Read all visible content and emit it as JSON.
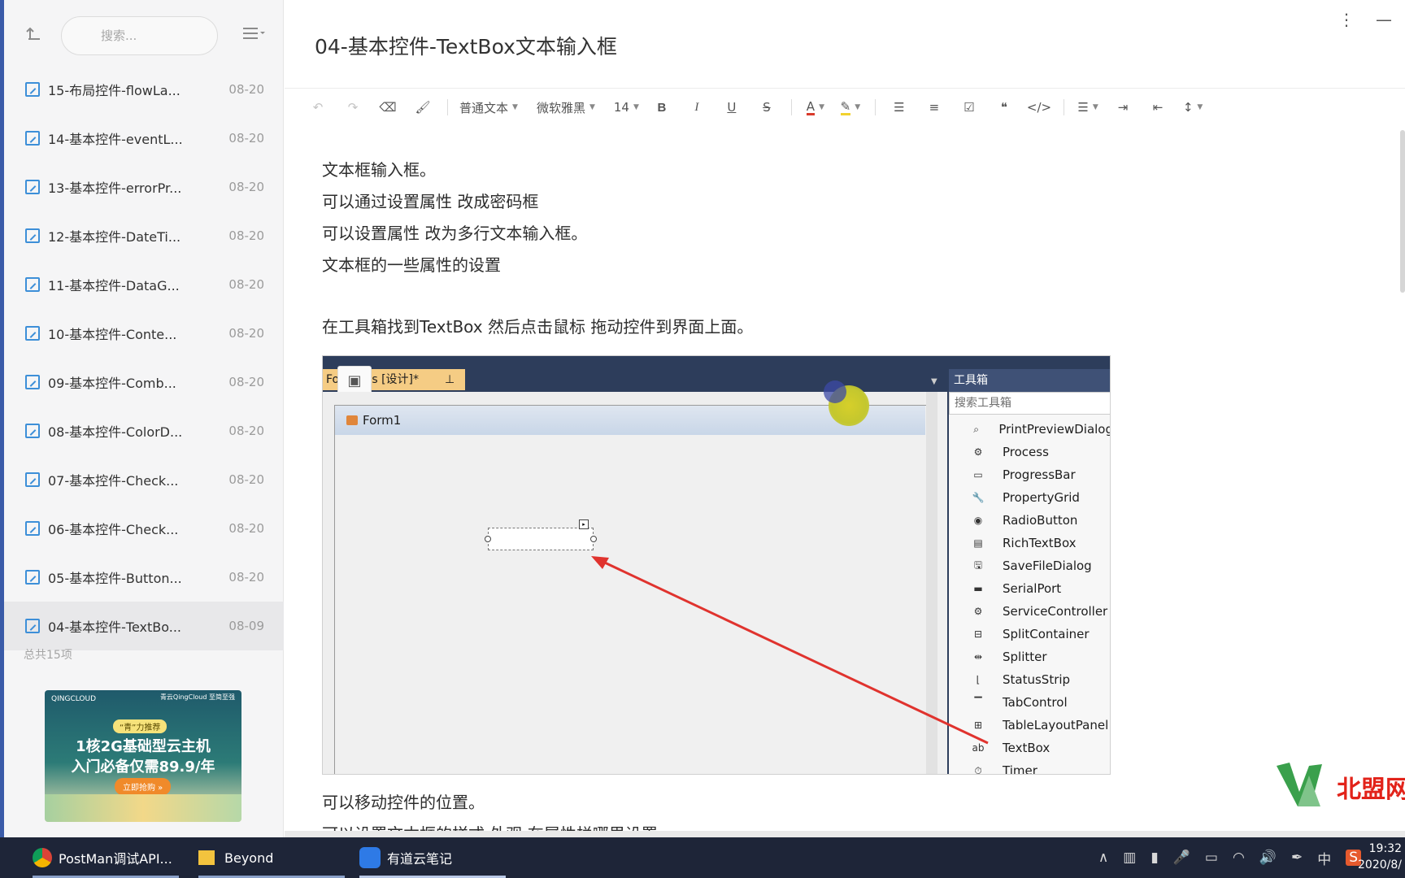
{
  "sidebar": {
    "search_placeholder": "搜索...",
    "items": [
      {
        "title": "15-布局控件-flowLa...",
        "date": "08-20"
      },
      {
        "title": "14-基本控件-eventL...",
        "date": "08-20"
      },
      {
        "title": "13-基本控件-errorPr...",
        "date": "08-20"
      },
      {
        "title": "12-基本控件-DateTi...",
        "date": "08-20"
      },
      {
        "title": "11-基本控件-DataG...",
        "date": "08-20"
      },
      {
        "title": "10-基本控件-Conte...",
        "date": "08-20"
      },
      {
        "title": "09-基本控件-Comb...",
        "date": "08-20"
      },
      {
        "title": "08-基本控件-ColorD...",
        "date": "08-20"
      },
      {
        "title": "07-基本控件-Check...",
        "date": "08-20"
      },
      {
        "title": "06-基本控件-Check...",
        "date": "08-20"
      },
      {
        "title": "05-基本控件-Button...",
        "date": "08-20"
      },
      {
        "title": "04-基本控件-TextBo...",
        "date": "08-09"
      }
    ],
    "count": "总共15项",
    "ad": {
      "brand": "QINGCLOUD",
      "top_right": "青云QingCloud 至简至强",
      "pill": "“青”力推荐",
      "line1": "1核2G基础型云主机",
      "line2": "入门必备仅需89.9/年",
      "button": "立即抢购 »"
    }
  },
  "doc": {
    "title": "04-基本控件-TextBox文本输入框",
    "toolbar": {
      "paragraph": "普通文本",
      "font": "微软雅黑",
      "size": "14"
    },
    "paragraphs_a": [
      "文本框输入框。",
      "可以通过设置属性 改成密码框",
      "可以设置属性 改为多行文本输入框。",
      "文本框的一些属性的设置"
    ],
    "para_b": "在工具箱找到TextBox 然后点击鼠标 拖动控件到界面上面。",
    "para_c": "可以移动控件的位置。",
    "para_d": "可以设置文本框的样式 外观 在属性栏哪里设置"
  },
  "screenshot": {
    "tab_label": "Form1.cs [设计]*",
    "form_title": "Form1",
    "toolbox_title": "工具箱",
    "toolbox_search": "搜索工具箱",
    "toolbox_items": [
      "PrintPreviewDialog",
      "Process",
      "ProgressBar",
      "PropertyGrid",
      "RadioButton",
      "RichTextBox",
      "SaveFileDialog",
      "SerialPort",
      "ServiceController",
      "SplitContainer",
      "Splitter",
      "StatusStrip",
      "TabControl",
      "TableLayoutPanel",
      "TextBox",
      "Timer"
    ]
  },
  "watermark": "北盟网校",
  "taskbar": {
    "tasks": [
      "PostMan调试API...",
      "Beyond",
      "有道云笔记"
    ],
    "ime": "中",
    "time": "19:32",
    "date": "2020/8/"
  },
  "colors": {
    "accent": "#3d8fd8",
    "taskbar": "#1e2538",
    "vs_dark": "#2d3d5b",
    "arrow": "#e0332e"
  }
}
